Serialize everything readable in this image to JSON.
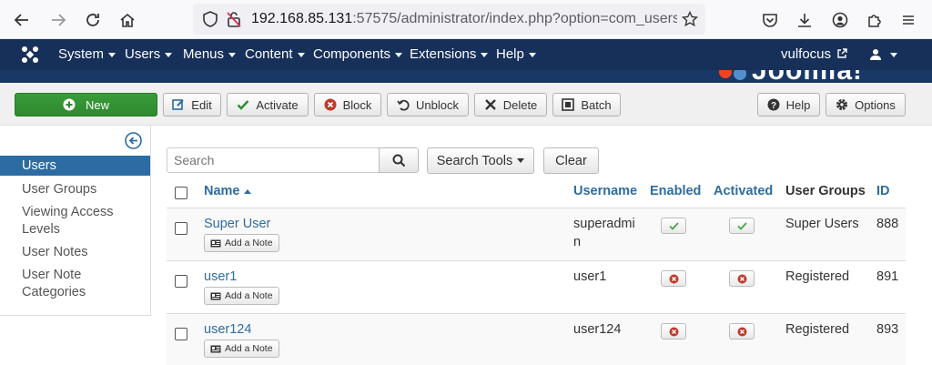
{
  "browser": {
    "url_host": "192.168.85.131",
    "url_path": ":57575/administrator/index.php?option=com_users",
    "icons": [
      "back-arrow-icon",
      "forward-arrow-icon",
      "reload-icon",
      "home-icon",
      "shield-icon",
      "insecure-lock-icon",
      "bookmark-star-icon",
      "pocket-icon",
      "download-icon",
      "account-icon",
      "extensions-icon",
      "menu-icon"
    ]
  },
  "admin_nav": {
    "menus": [
      "System",
      "Users",
      "Menus",
      "Content",
      "Components",
      "Extensions",
      "Help"
    ],
    "site_link": "vulfocus",
    "brand": "Joomla!"
  },
  "toolbar": {
    "new": "New",
    "edit": "Edit",
    "activate": "Activate",
    "block": "Block",
    "unblock": "Unblock",
    "delete": "Delete",
    "batch": "Batch",
    "help": "Help",
    "options": "Options"
  },
  "sidebar": {
    "items": [
      {
        "label": "Users",
        "active": true
      },
      {
        "label": "User Groups"
      },
      {
        "label": "Viewing Access Levels"
      },
      {
        "label": "User Notes"
      },
      {
        "label": "User Note Categories"
      }
    ]
  },
  "filters": {
    "search_placeholder": "Search",
    "search_tools": "Search Tools",
    "clear": "Clear"
  },
  "table": {
    "headers": {
      "name": "Name",
      "username": "Username",
      "enabled": "Enabled",
      "activated": "Activated",
      "user_groups": "User Groups",
      "id": "ID"
    },
    "add_note_label": "Add a Note",
    "rows": [
      {
        "name": "Super User",
        "username_line1": "superadmi",
        "username_line2": "n",
        "enabled": "check",
        "activated": "check",
        "groups": "Super Users",
        "id": "888"
      },
      {
        "name": "user1",
        "username_line1": "user1",
        "username_line2": "",
        "enabled": "blocked",
        "activated": "blocked",
        "groups": "Registered",
        "id": "891"
      },
      {
        "name": "user124",
        "username_line1": "user124",
        "username_line2": "",
        "enabled": "blocked",
        "activated": "blocked",
        "groups": "Registered",
        "id": "893"
      }
    ]
  },
  "colors": {
    "nav_bg": "#17305a",
    "accent": "#2d6ca2",
    "success": "#2e8a2e",
    "danger": "#c0392b"
  }
}
